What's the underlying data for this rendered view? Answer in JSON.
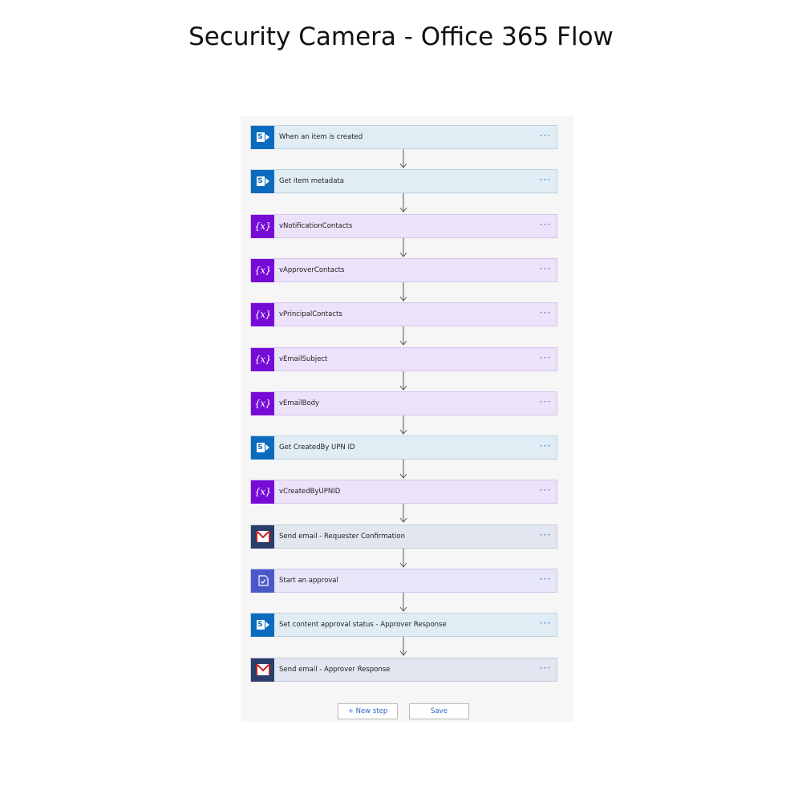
{
  "title": "Security Camera - Office 365 Flow",
  "colors": {
    "sharepoint": "#0b6cbf",
    "variable": "#770bd6",
    "email": "#2a3d6b",
    "approval": "#4b58c9",
    "link": "#2f63c6"
  },
  "steps": [
    {
      "label": "When an item is created",
      "icon": "sharepoint-icon",
      "kind": "sp",
      "more": "···"
    },
    {
      "label": "Get item metadata",
      "icon": "sharepoint-icon",
      "kind": "sp",
      "more": "···"
    },
    {
      "label": "vNotificationContacts",
      "icon": "variable-icon",
      "kind": "var",
      "more": "···"
    },
    {
      "label": "vApproverContacts",
      "icon": "variable-icon",
      "kind": "var",
      "more": "···"
    },
    {
      "label": "vPrincipalContacts",
      "icon": "variable-icon",
      "kind": "var",
      "more": "···"
    },
    {
      "label": "vEmailSubject",
      "icon": "variable-icon",
      "kind": "var",
      "more": "···"
    },
    {
      "label": "vEmailBody",
      "icon": "variable-icon",
      "kind": "var",
      "more": "···"
    },
    {
      "label": "Get CreatedBy UPN ID",
      "icon": "sharepoint-icon",
      "kind": "sp",
      "more": "···"
    },
    {
      "label": "vCreatedByUPNID",
      "icon": "variable-icon",
      "kind": "var",
      "more": "···"
    },
    {
      "label": "Send email - Requester Confirmation",
      "icon": "gmail-icon",
      "kind": "gm",
      "more": "···"
    },
    {
      "label": "Start an approval",
      "icon": "approval-icon",
      "kind": "ap",
      "more": "···"
    },
    {
      "label": "Set content approval status - Approver Response",
      "icon": "sharepoint-icon",
      "kind": "sp",
      "more": "···"
    },
    {
      "label": "Send email - Approver Response",
      "icon": "gmail-icon",
      "kind": "gm",
      "more": "···"
    }
  ],
  "variable_glyph": "{x}",
  "sharepoint_glyph": "S",
  "buttons": {
    "new_step": "+ New step",
    "save": "Save"
  }
}
